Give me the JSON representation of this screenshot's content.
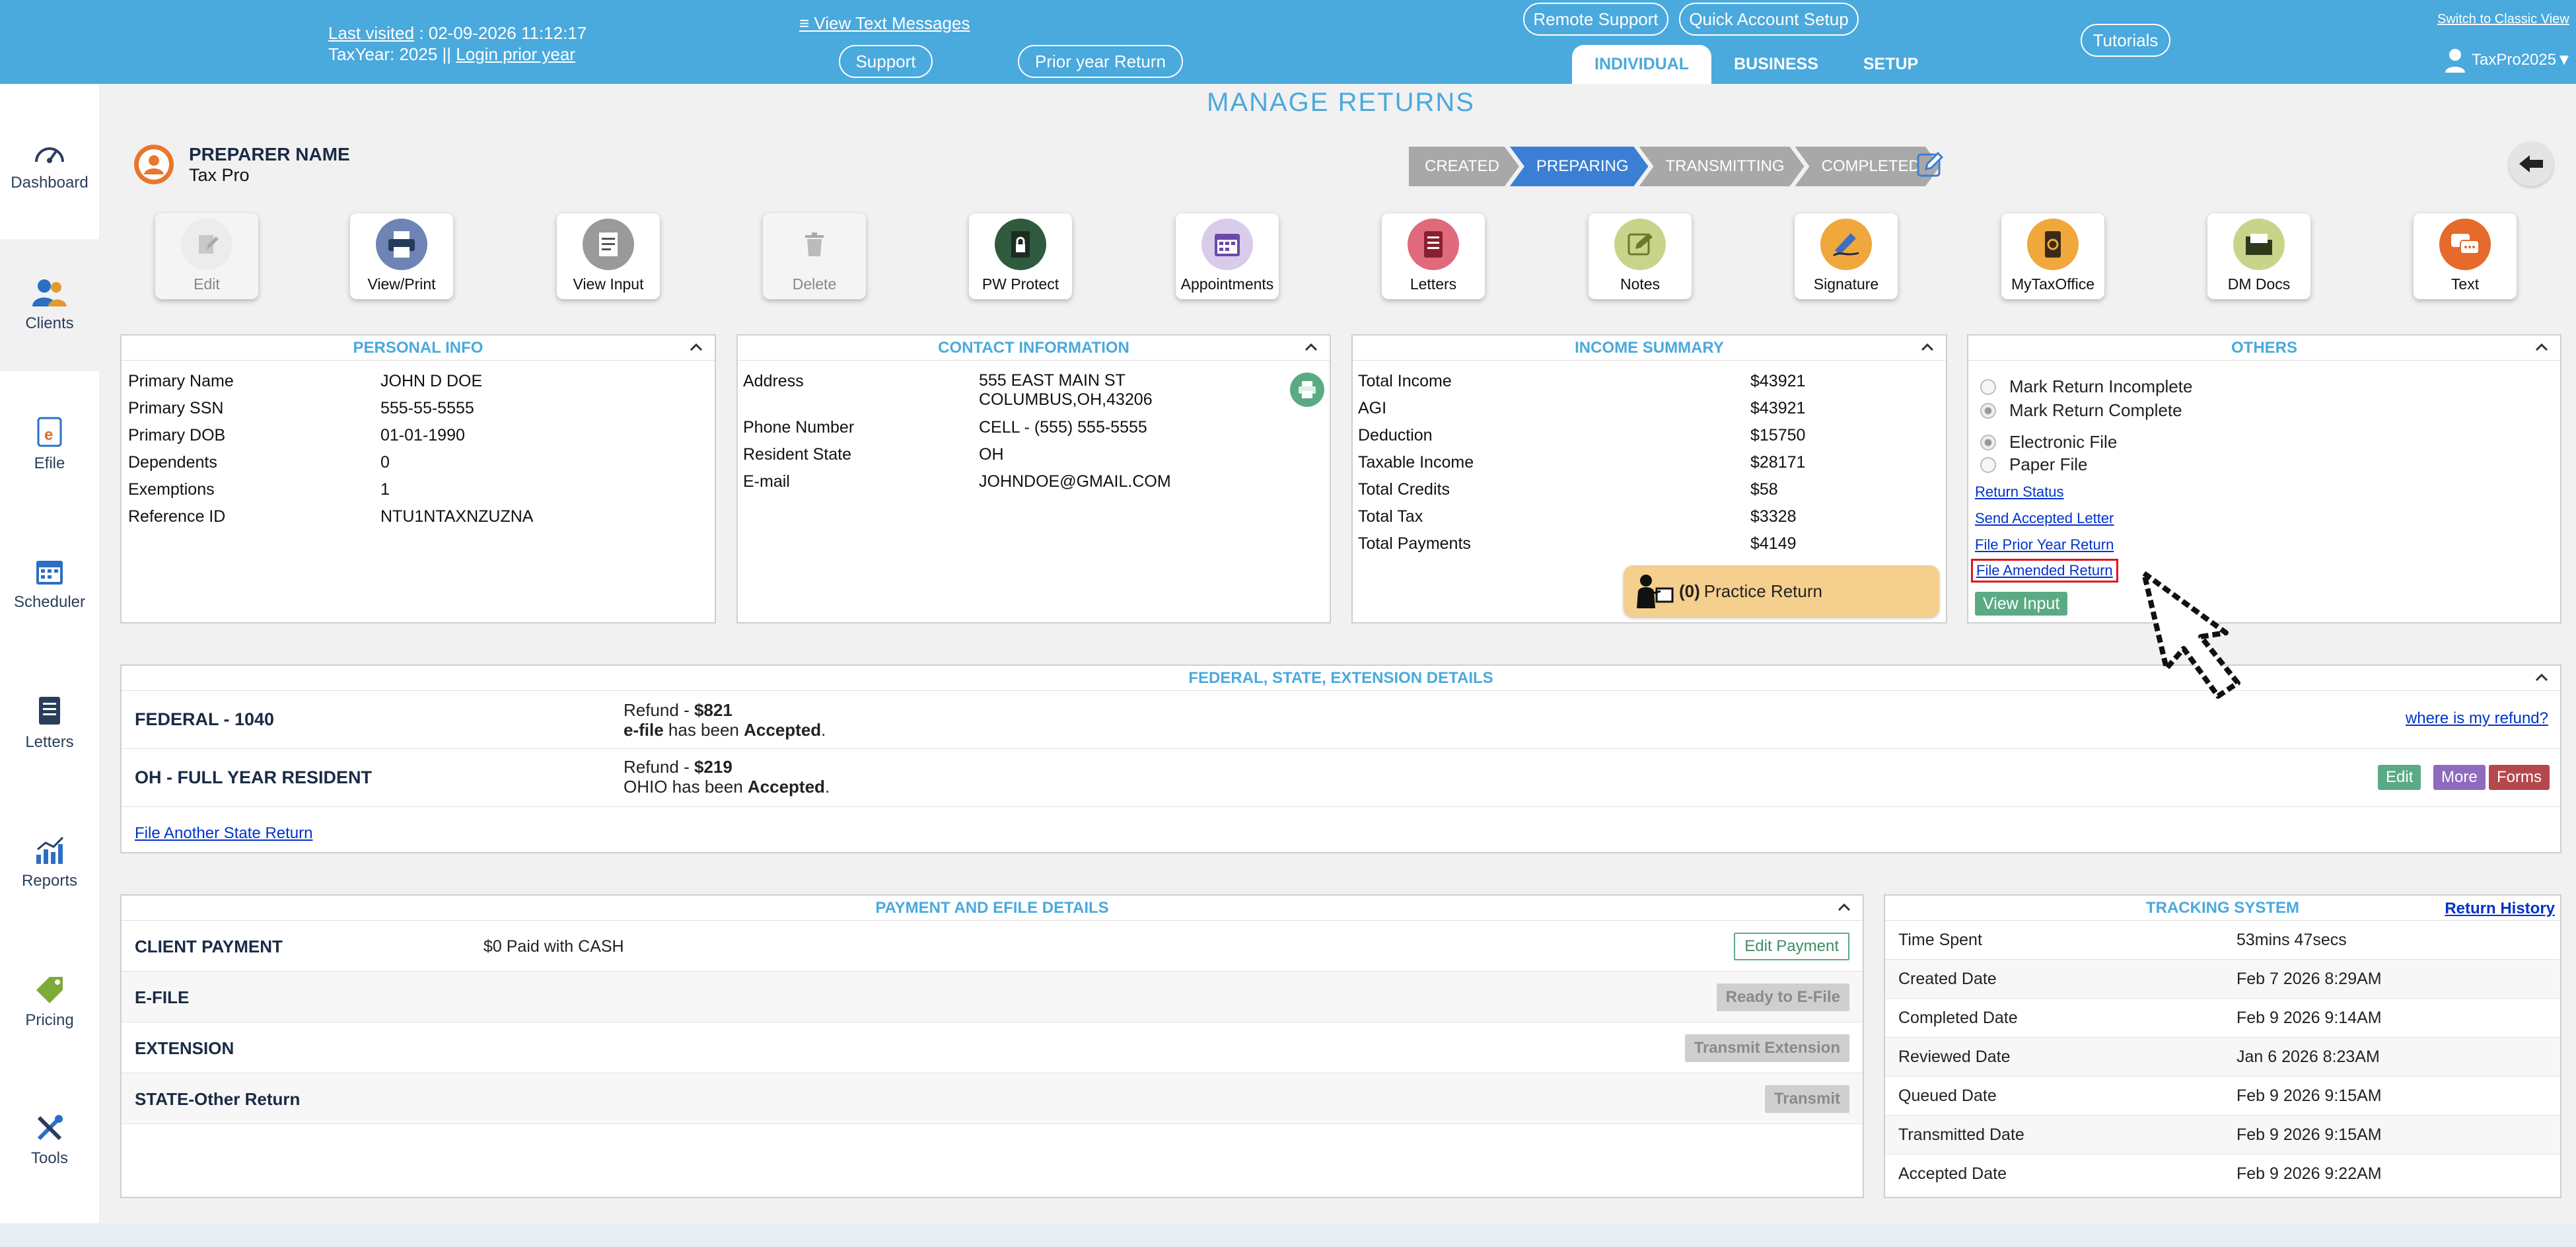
{
  "topbar": {
    "last_visited_label": "Last visited",
    "last_visited_value": ": 02-09-2026 11:12:17",
    "taxyear_label": "TaxYear:",
    "taxyear_value": "2025",
    "taxyear_sep": "||",
    "login_prior_year": "Login prior year",
    "view_text_messages": "≡ View Text Messages",
    "support": "Support",
    "prior_year_return": "Prior year Return",
    "remote_support": "Remote Support",
    "quick_account_setup": "Quick Account Setup",
    "tutorials": "Tutorials",
    "switch_classic": "Switch to Classic View",
    "tabs": [
      "INDIVIDUAL",
      "BUSINESS",
      "SETUP"
    ],
    "user": "TaxPro2025▼"
  },
  "sidebar": [
    "Dashboard",
    "Clients",
    "Efile",
    "Scheduler",
    "Letters",
    "Reports",
    "Pricing",
    "Tools"
  ],
  "page_title": "MANAGE RETURNS",
  "preparer": {
    "name": "PREPARER NAME",
    "role": "Tax Pro"
  },
  "steps": [
    "CREATED",
    "PREPARING",
    "TRANSMITTING",
    "COMPLETED"
  ],
  "toolbar": [
    "Edit",
    "View/Print",
    "View Input",
    "Delete",
    "PW Protect",
    "Appointments",
    "Letters",
    "Notes",
    "Signature",
    "MyTaxOffice",
    "DM Docs",
    "Text"
  ],
  "personal": {
    "title": "PERSONAL INFO",
    "rows": [
      [
        "Primary Name",
        "JOHN D DOE"
      ],
      [
        "Primary SSN",
        "555-55-5555"
      ],
      [
        "Primary DOB",
        "01-01-1990"
      ],
      [
        "Dependents",
        "0"
      ],
      [
        "Exemptions",
        "1"
      ],
      [
        "Reference ID",
        "NTU1NTAXNZUZNA"
      ]
    ]
  },
  "contact": {
    "title": "CONTACT INFORMATION",
    "address_label": "Address",
    "address_line1": "555 EAST MAIN ST",
    "address_line2": "COLUMBUS,OH,43206",
    "phone_label": "Phone Number",
    "phone_value": "CELL - (555) 555-5555",
    "state_label": "Resident State",
    "state_value": "OH",
    "email_label": "E-mail",
    "email_value": "JOHNDOE@GMAIL.COM"
  },
  "income": {
    "title": "INCOME SUMMARY",
    "rows": [
      [
        "Total Income",
        "$43921"
      ],
      [
        "AGI",
        "$43921"
      ],
      [
        "Deduction",
        "$15750"
      ],
      [
        "Taxable Income",
        "$28171"
      ],
      [
        "Total Credits",
        "$58"
      ],
      [
        "Total Tax",
        "$3328"
      ],
      [
        "Total Payments",
        "$4149"
      ]
    ],
    "practice_count": "(0)",
    "practice_label": "Practice Return"
  },
  "others": {
    "title": "OTHERS",
    "mark_incomplete": "Mark Return Incomplete",
    "mark_complete": "Mark Return Complete",
    "electronic_file": "Electronic File",
    "paper_file": "Paper File",
    "return_status": "Return Status",
    "send_accepted_letter": "Send Accepted Letter",
    "file_prior_year": "File Prior Year Return",
    "file_amended": "File Amended Return",
    "view_input": "View Input"
  },
  "federal": {
    "title": "FEDERAL, STATE, EXTENSION DETAILS",
    "fed_name": "FEDERAL - 1040",
    "fed_refund_label": "Refund - ",
    "fed_refund_value": "$821",
    "fed_status_prefix": "e-file",
    "fed_status_mid": " has been ",
    "fed_status_value": "Accepted",
    "where_refund": "where is my refund?",
    "state_name": "OH - FULL YEAR RESIDENT",
    "state_refund_label": "Refund - ",
    "state_refund_value": "$219",
    "state_status_prefix": "OHIO has been ",
    "state_status_value": "Accepted",
    "edit": "Edit",
    "more": "More",
    "forms": "Forms",
    "file_another": "File Another State Return"
  },
  "payment": {
    "title": "PAYMENT AND EFILE DETAILS",
    "client_payment": "CLIENT PAYMENT",
    "client_payment_value": "$0 Paid with CASH",
    "edit_payment": "Edit Payment",
    "efile": "E-FILE",
    "ready_efile": "Ready to E-File",
    "extension": "EXTENSION",
    "transmit_extension": "Transmit Extension",
    "state_other": "STATE-Other Return",
    "transmit": "Transmit"
  },
  "tracking": {
    "title": "TRACKING SYSTEM",
    "history": "Return History",
    "rows": [
      [
        "Time Spent",
        "53mins 47secs"
      ],
      [
        "Created Date",
        "Feb 7 2026 8:29AM"
      ],
      [
        "Completed Date",
        "Feb 9 2026 9:14AM"
      ],
      [
        "Reviewed Date",
        "Jan 6 2026 8:23AM"
      ],
      [
        "Queued Date",
        "Feb 9 2026 9:15AM"
      ],
      [
        "Transmitted Date",
        "Feb 9 2026 9:15AM"
      ],
      [
        "Accepted Date",
        "Feb 9 2026 9:22AM"
      ]
    ]
  },
  "colors": {
    "brand": "#4aa9dd",
    "active_step": "#3a7fd4",
    "green_btn": "#5aab84",
    "purple_btn": "#8e6bbf",
    "red_btn": "#b5484c"
  }
}
